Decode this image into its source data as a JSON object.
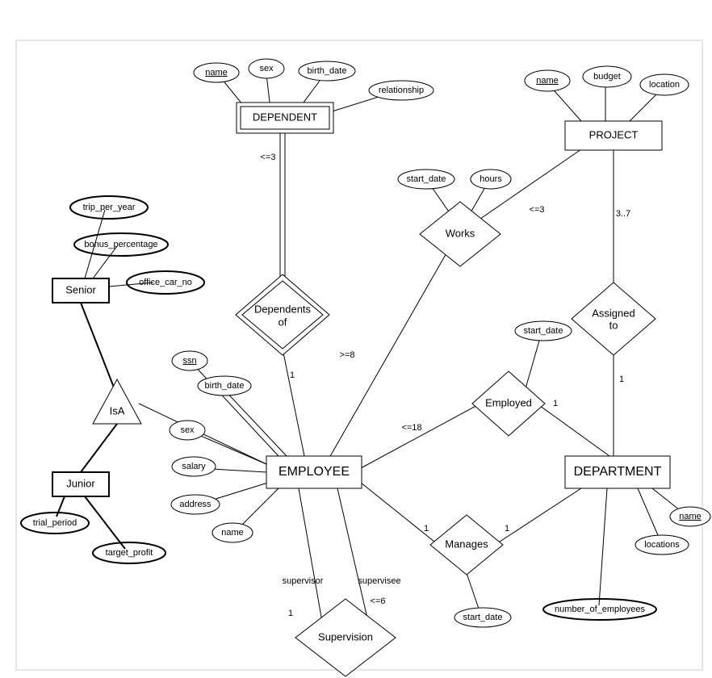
{
  "entities": {
    "dependent": "DEPENDENT",
    "project": "PROJECT",
    "senior": "Senior",
    "junior": "Junior",
    "employee": "EMPLOYEE",
    "department": "DEPARTMENT"
  },
  "relationships": {
    "works": "Works",
    "dependents_of_1": "Dependents",
    "dependents_of_2": "of",
    "assigned_to_1": "Assigned",
    "assigned_to_2": "to",
    "isa": "IsA",
    "employed": "Employed",
    "manages": "Manages",
    "supervision": "Supervision"
  },
  "attributes": {
    "dep_name": "name",
    "dep_sex": "sex",
    "dep_birth_date": "birth_date",
    "dep_relationship": "relationship",
    "proj_name": "name",
    "proj_budget": "budget",
    "proj_location": "location",
    "works_start_date": "start_date",
    "works_hours": "hours",
    "senior_trip": "trip_per_year",
    "senior_bonus": "bonus_percentage",
    "senior_car": "office_car_no",
    "emp_ssn": "ssn",
    "emp_birth_date": "birth_date",
    "emp_sex": "sex",
    "emp_salary": "salary",
    "emp_address": "address",
    "emp_name": "name",
    "junior_trial": "trial_period",
    "junior_target": "target_profit",
    "employed_start": "start_date",
    "dept_name": "name",
    "dept_locations": "locations",
    "dept_num_emp": "number_of_employees",
    "manages_start": "start_date"
  },
  "labels": {
    "dep_le3": "<=3",
    "works_le3": "<=3",
    "proj_37": "3..7",
    "ge8": ">=8",
    "one_a": "1",
    "one_b": "1",
    "one_c": "1",
    "one_d": "1",
    "one_e": "1",
    "one_f": "1",
    "le18": "<=18",
    "le6": "<=6",
    "supervisor": "supervisor",
    "supervisee": "supervisee"
  }
}
